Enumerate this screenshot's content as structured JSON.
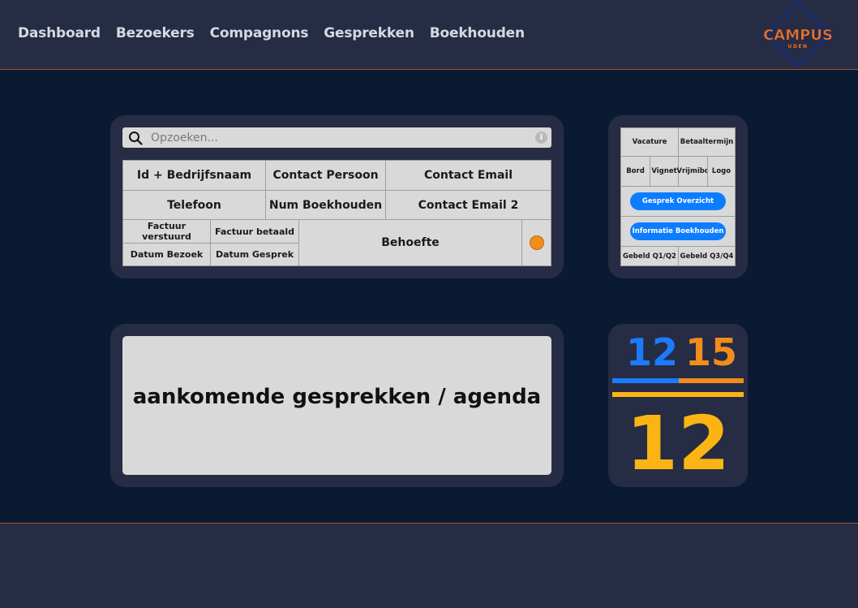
{
  "nav": {
    "items": [
      "Dashboard",
      "Bezoekers",
      "Compagnons",
      "Gesprekken",
      "Boekhouden"
    ]
  },
  "logo": {
    "text": "CAMPUS",
    "subtext": "UDEN"
  },
  "search": {
    "placeholder": "Opzoeken...",
    "info_icon": "i"
  },
  "fields": {
    "id_bedrijfsnaam": "Id + Bedrijfsnaam",
    "contact_persoon": "Contact Persoon",
    "contact_email": "Contact Email",
    "telefoon": "Telefoon",
    "num_boekhouden": "Num Boekhouden",
    "contact_email_2": "Contact Email 2",
    "factuur_verstuurd": "Factuur verstuurd",
    "factuur_betaald": "Factuur betaald",
    "datum_bezoek": "Datum Bezoek",
    "datum_gesprek": "Datum Gesprek",
    "behoefte": "Behoefte"
  },
  "options": {
    "vacature": "Vacature",
    "betaaltermijn": "Betaaltermijn",
    "bord": "Bord",
    "vignet": "Vignet",
    "vrijmibo": "Vrijmibo",
    "logo": "Logo",
    "gesprek_overzicht": "Gesprek Overzicht",
    "informatie_boekhouden": "Informatie Boekhouden",
    "gebeld_q1q2": "Gebeld Q1/Q2",
    "gebeld_q3q4": "Gebeld Q3/Q4"
  },
  "agenda": {
    "title": "aankomende gesprekken / agenda"
  },
  "stats": {
    "blue": "12",
    "orange": "15",
    "total": "12"
  },
  "colors": {
    "background": "#0b1a33",
    "panel": "#252c44",
    "accent_blue": "#1b7bff",
    "accent_orange": "#f28c1c",
    "accent_yellow": "#fcb414",
    "cell": "#d9d9d9"
  },
  "icons": {
    "search": "search-icon",
    "info": "info-icon",
    "status": "status-dot-icon"
  }
}
